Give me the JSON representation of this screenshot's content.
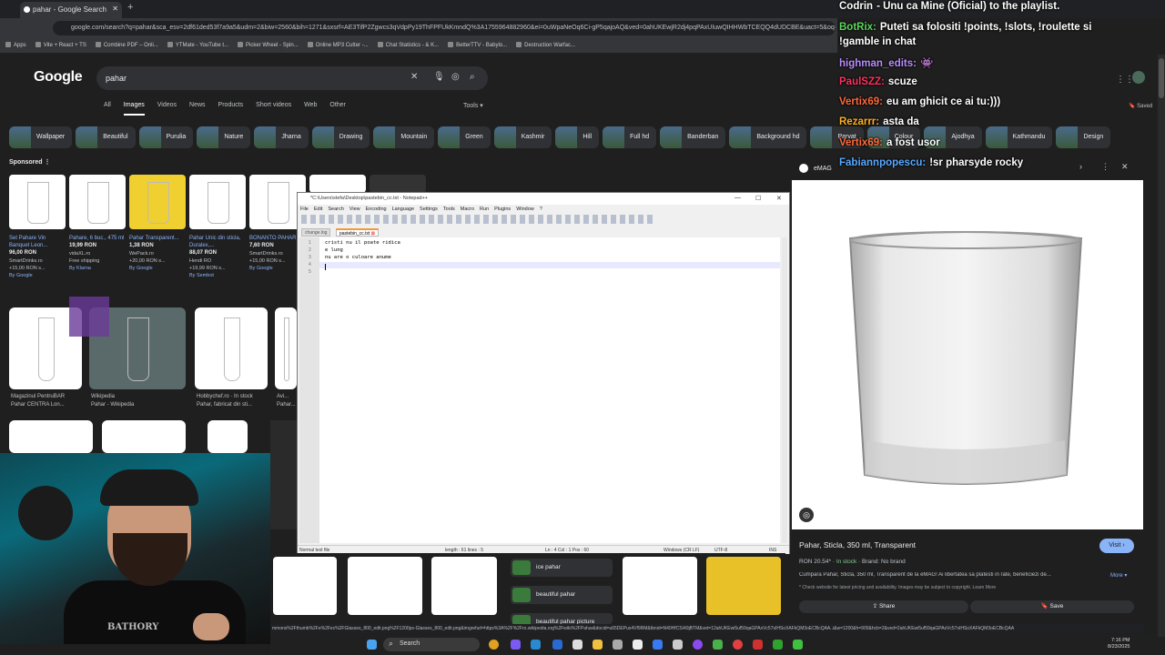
{
  "browser": {
    "tab_title": "pahar - Google Search",
    "url": "google.com/search?q=pahar&sca_esv=2df61ded53f7a9a5&udm=2&biw=2560&bih=1271&sxsrf=AE3TifP2Zgwcs3qVdpPy19ThFPFUkKmndQ%3A1755964882960&ei=0uWpaNeOq6Ci-gP5qajoAQ&ved=0ahUKEwjR2dj4pqPAxUIuwQIHHWbTCEQQ4dUDCBE&uact=5&oq=p",
    "bookmarks": [
      "Apps",
      "Vite + React + TS",
      "Combine PDF – Onli...",
      "YTMate - YouTube t...",
      "Picker Wheel - Spin...",
      "Online MP3 Cutter -...",
      "Chat Statistics - & K...",
      "BetterTTV - Babylo...",
      "Destruction Warfac..."
    ]
  },
  "google": {
    "logo": "Google",
    "query": "pahar",
    "tabs": [
      "All",
      "Images",
      "Videos",
      "News",
      "Products",
      "Short videos",
      "Web",
      "Other"
    ],
    "active_tab": "Images",
    "tools": "Tools",
    "saved": "Saved",
    "chips": [
      "Wallpaper",
      "Beautiful",
      "Purulia",
      "Nature",
      "Jharna",
      "Drawing",
      "Mountain",
      "Green",
      "Kashmir",
      "Hill",
      "Full hd",
      "Banderban",
      "Background hd",
      "Parvat",
      "Colour",
      "Ajodhya",
      "Kathmandu",
      "Design"
    ],
    "sponsored": "Sponsored",
    "products": [
      {
        "title": "Set Pahare Vin Banquet Leon...",
        "price": "96,00 RON",
        "store": "SmartDrinks.ro",
        "ship": "+15,00 RON s...",
        "by": "By Google"
      },
      {
        "title": "Pahare, 6 buc., 475 ml",
        "price": "19,99 RON",
        "store": "vidaXL.ro",
        "ship": "Free shipping",
        "by": "By Klarna"
      },
      {
        "title": "Pahar Transparent...",
        "price": "1,38 RON",
        "store": "WePack.ro",
        "ship": "+20,00 RON s...",
        "by": "By Google"
      },
      {
        "title": "Pahar Unic din sticla, Duralex,...",
        "price": "88,07 RON",
        "store": "Hendi RO",
        "ship": "+19,99 RON s...",
        "by": "By Sembot"
      },
      {
        "title": "BONANTO PAHAR",
        "price": "7,60 RON",
        "store": "SmartDrinks.ro",
        "ship": "+15,00 RON s...",
        "by": "By Google"
      }
    ],
    "results": [
      {
        "source": "Magazinul PentruBAR",
        "title": "Pahar CENTRA Lon..."
      },
      {
        "source": "Wikipedia",
        "title": "Pahar - Wikipedia"
      },
      {
        "source": "Hobbychef.ro · In stock",
        "title": "Pahar, fabricat din sti..."
      },
      {
        "source": "Avi...",
        "title": "Pahar..."
      }
    ],
    "suggestions": [
      "ice pahar",
      "beautiful pahar",
      "beautiful pahar picture"
    ],
    "status_url": "mmons%2Fthumb%2Fe%2Fec%2FGlasses_800_edit.png%2F1200px-Glasses_800_edit.png&imgrefurl=https%3A%2F%2Fro.wikipedia.org%2Fwiki%2FPahar&docid=u65DEPus4Vf9RM&tbnid=N40HfCSI49jBTM&vet=12ahUKEwi5uf59qaGPAxVc57sIHSoXAFkQM3oECBcQAA..i&w=1200&h=900&hcb=2&ved=2ahUKEwi5uf59qaGPAxVc57sIHSoXAFkQM3oECBcQAA"
  },
  "preview": {
    "source": "eMAG",
    "title": "Pahar, Sticla, 350 ml, Transparent",
    "visit": "Visit",
    "price": "RON 20.54*",
    "stock": "In stock",
    "brand": "Brand: No brand",
    "description": "Cumpara Pahar, Sticla, 350 ml, Transparent de la eMAG! Ai libertatea sa platesti in rate, beneficiezi de...",
    "more": "More",
    "note": "* Check website for latest pricing and availability. Images may be subject to copyright. Learn More",
    "share": "Share",
    "save": "Save"
  },
  "notepad": {
    "title": "*C:\\Users\\stefa\\Desktop\\pastebin_cc.txt - Notepad++",
    "menu": [
      "File",
      "Edit",
      "Search",
      "View",
      "Encoding",
      "Language",
      "Settings",
      "Tools",
      "Macro",
      "Run",
      "Plugins",
      "Window",
      "?"
    ],
    "tabs": [
      "change.log",
      "pastebin_cc.txt"
    ],
    "lines": [
      "cristi nu il poate ridica",
      "e lung",
      "nu are o culoare anume",
      "",
      ""
    ],
    "status_type": "Normal text file",
    "status_len": "length : 61    lines : 5",
    "status_pos": "Ln : 4    Col : 1    Pos : 60",
    "status_eol": "Windows (CR LF)",
    "status_enc": "UTF-8",
    "status_ins": "INS"
  },
  "chat": [
    {
      "user": "Codrin",
      "text": "- Unu ca Mine (Oficial) to the playlist.",
      "color": "#ffffff"
    },
    {
      "user": "BotRix:",
      "text": "Puteti sa folositi !points, !slots, !roulette si",
      "color": "#5cd65c"
    },
    {
      "user": "",
      "text": "!gamble in chat",
      "color": "#ffffff"
    },
    {
      "user": "highman_edits:",
      "text": "👾",
      "color": "#b98cff"
    },
    {
      "user": "PaulSZZ:",
      "text": "scuze",
      "color": "#ff3060"
    },
    {
      "user": "Vertix69:",
      "text": "eu am ghicit ce ai tu:)))",
      "color": "#ff6a3c"
    },
    {
      "user": "Rezarrr:",
      "text": "asta da",
      "color": "#ffb020"
    },
    {
      "user": "Vertix69:",
      "text": "a fost usor",
      "color": "#ff6a3c"
    },
    {
      "user": "Fabiannpopescu:",
      "text": "!sr pharsyde rocky",
      "color": "#5aa9ff"
    }
  ],
  "webcam": {
    "shirt_text": "BATHORY"
  },
  "taskbar": {
    "search": "Search",
    "time": "7:16 PM",
    "date": "8/23/2025"
  }
}
